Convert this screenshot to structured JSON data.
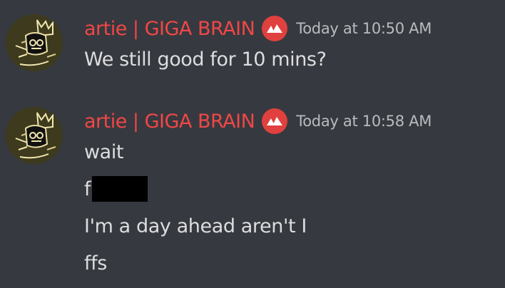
{
  "messages": [
    {
      "author": "artie | GIGA BRAIN",
      "timestamp": "Today at 10:50 AM",
      "lines": [
        "We still good for 10 mins?"
      ]
    },
    {
      "author": "artie | GIGA BRAIN",
      "timestamp": "Today at 10:58 AM",
      "lines": [
        "wait",
        "f",
        "I'm a day ahead aren't I",
        "ffs"
      ]
    }
  ],
  "icons": {
    "avatar": "crowned-figure-avatar-icon",
    "role_badge": "mountain-badge-icon"
  },
  "colors": {
    "background": "#36393f",
    "username": "#f04747",
    "badge": "#e0413e",
    "text": "#dcddde",
    "timestamp": "#b9bbbe",
    "redaction": "#000000"
  }
}
